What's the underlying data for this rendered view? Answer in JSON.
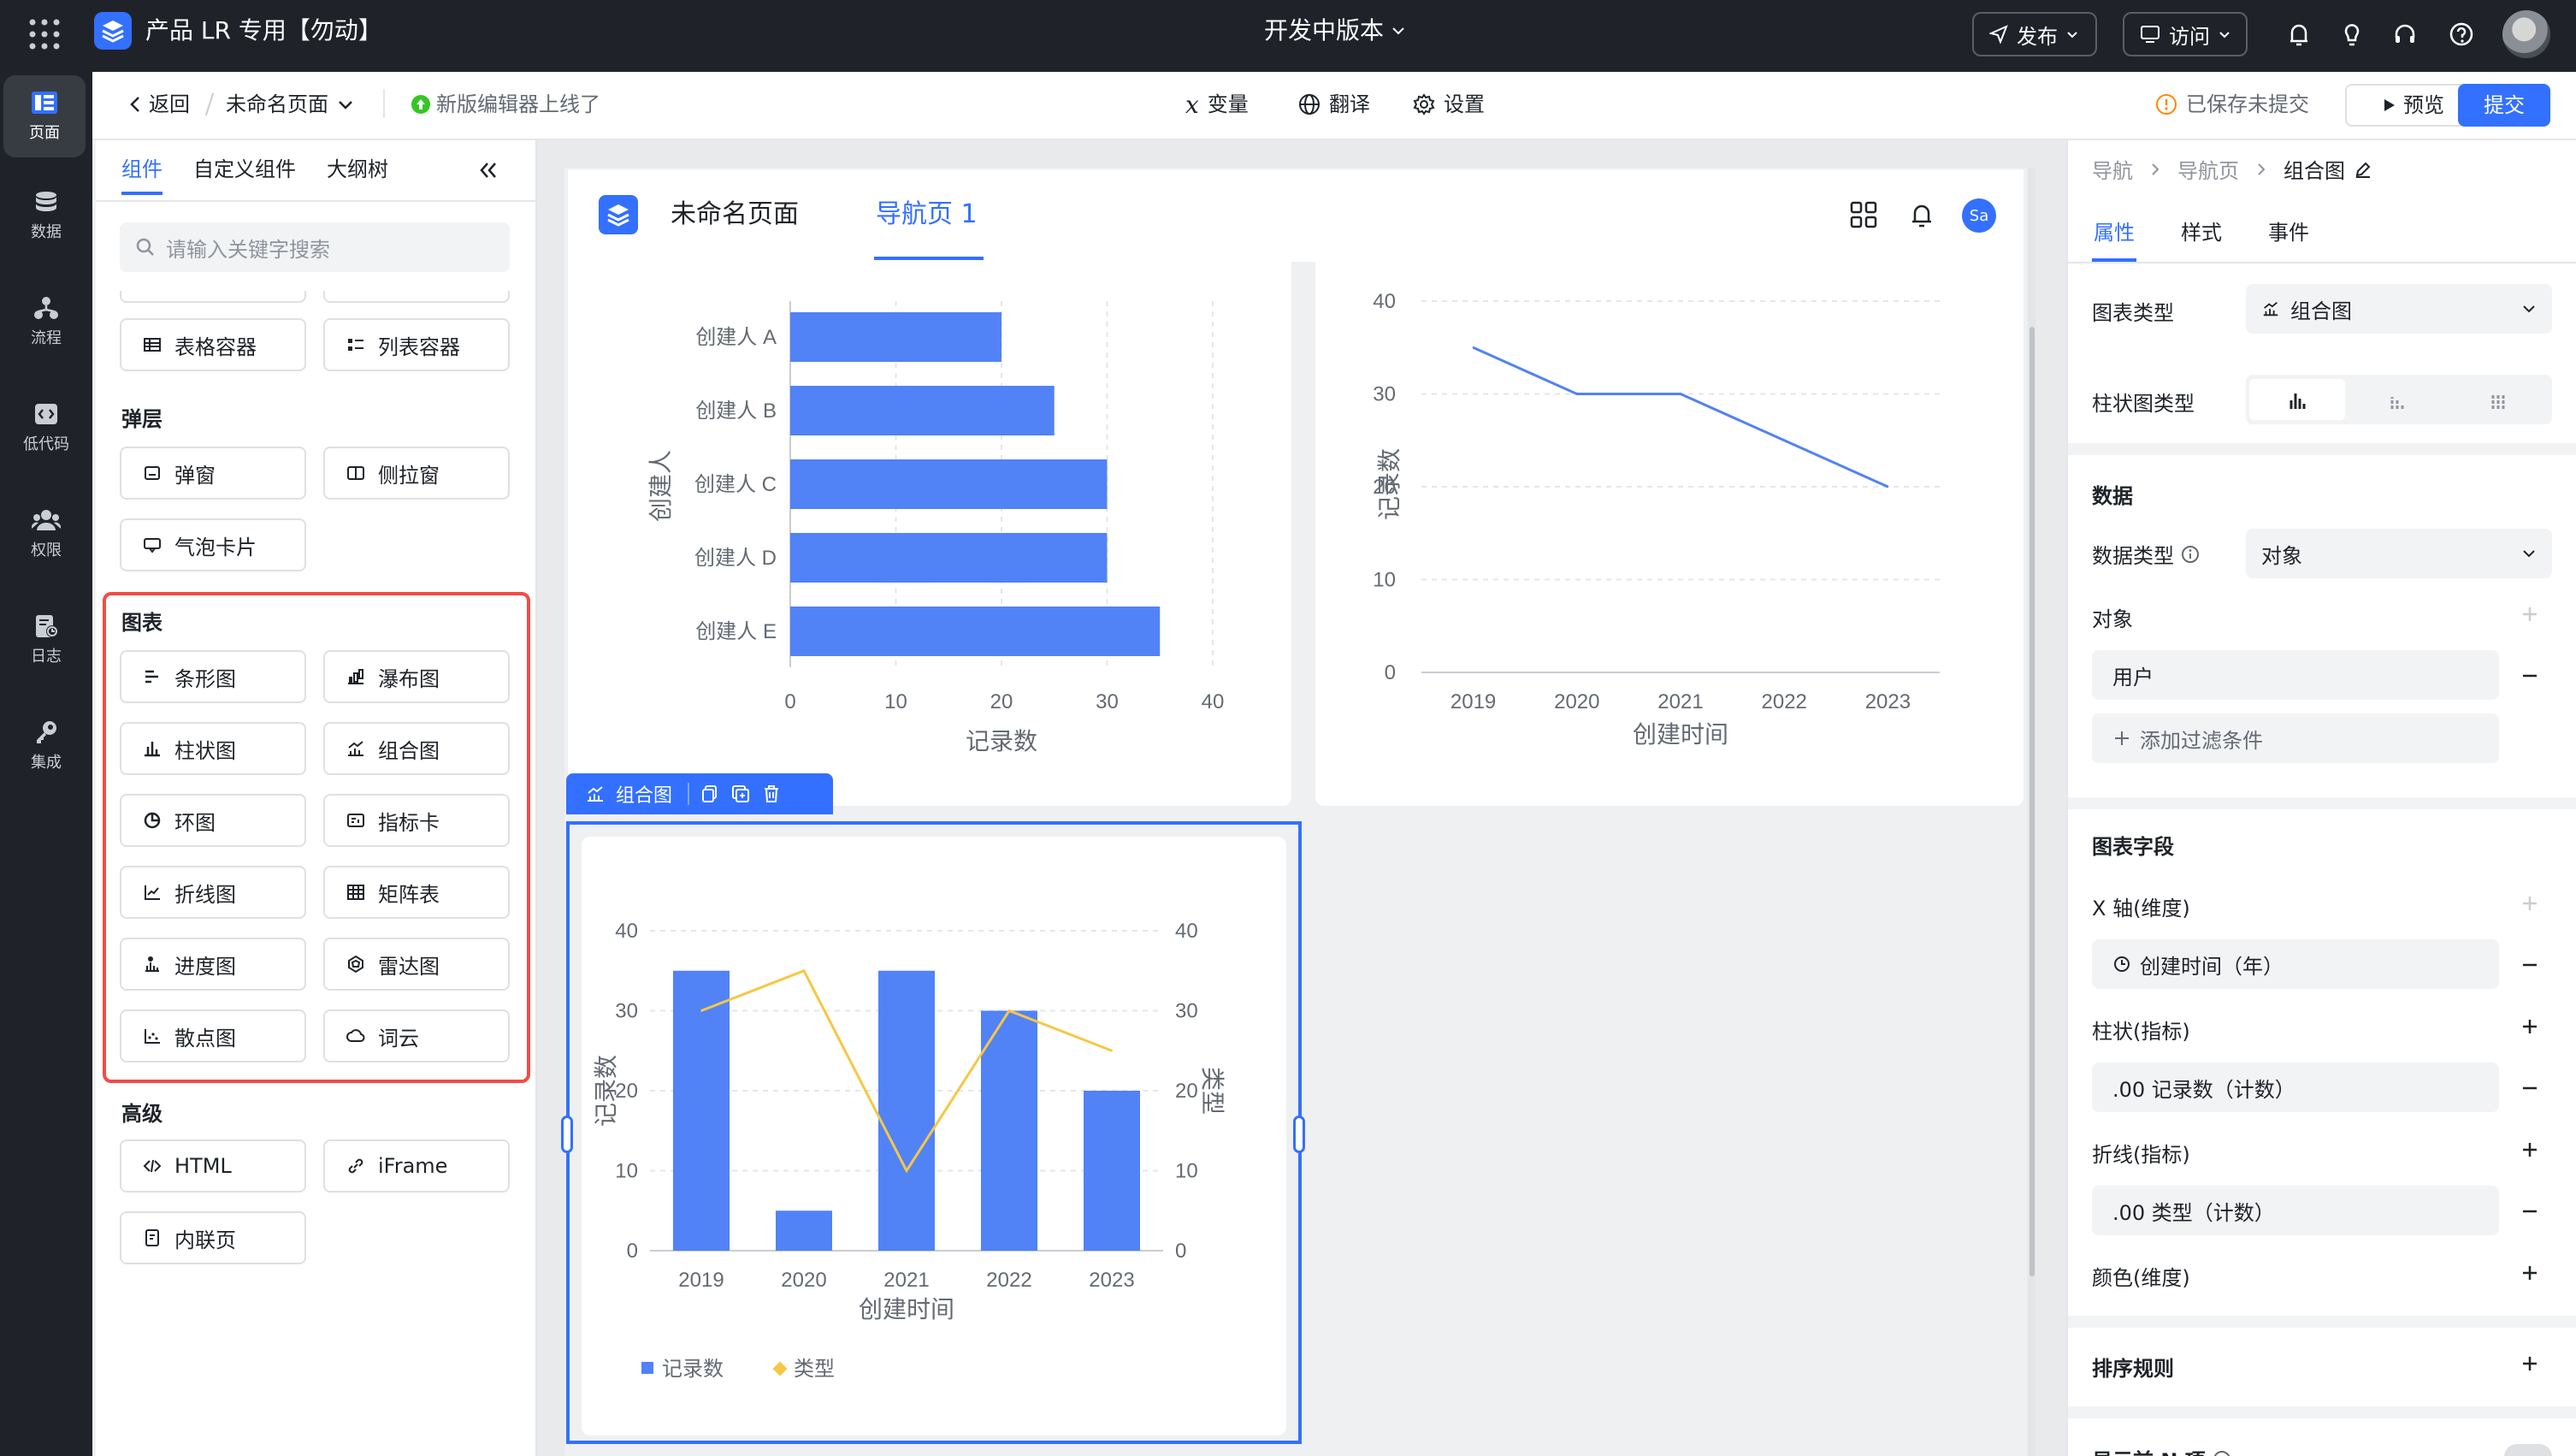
{
  "topbar": {
    "app_title": "产品 LR 专用【勿动】",
    "version": "开发中版本",
    "publish_label": "发布",
    "visit_label": "访问"
  },
  "rail": {
    "items": [
      {
        "label": "页面",
        "icon": "page-icon"
      },
      {
        "label": "数据",
        "icon": "database-icon"
      },
      {
        "label": "流程",
        "icon": "flow-icon"
      },
      {
        "label": "低代码",
        "icon": "code-icon"
      },
      {
        "label": "权限",
        "icon": "users-icon"
      },
      {
        "label": "日志",
        "icon": "log-icon"
      },
      {
        "label": "集成",
        "icon": "key-icon"
      }
    ]
  },
  "subbar": {
    "back_label": "返回",
    "page_name": "未命名页面",
    "notice": "新版编辑器上线了",
    "variables_label": "变量",
    "translate_label": "翻译",
    "settings_label": "设置",
    "saved_status": "已保存未提交",
    "preview_label": "预览",
    "submit_label": "提交"
  },
  "left_panel": {
    "tabs": [
      "组件",
      "自定义组件",
      "大纲树"
    ],
    "search_placeholder": "请输入关键字搜索",
    "containers": [
      "表格容器",
      "列表容器"
    ],
    "popup_title": "弹层",
    "popups": [
      "弹窗",
      "侧拉窗",
      "气泡卡片"
    ],
    "chart_title": "图表",
    "charts": [
      "条形图",
      "瀑布图",
      "柱状图",
      "组合图",
      "环图",
      "指标卡",
      "折线图",
      "矩阵表",
      "进度图",
      "雷达图",
      "散点图",
      "词云"
    ],
    "advanced_title": "高级",
    "advanced": [
      "HTML",
      "iFrame",
      "内联页"
    ]
  },
  "page_header": {
    "title": "未命名页面",
    "nav_tab": "导航页 1",
    "avatar": "Sa"
  },
  "selection_toolbar": {
    "label": "组合图"
  },
  "chart_data": [
    {
      "type": "bar",
      "orientation": "horizontal",
      "categories": [
        "创建人 A",
        "创建人 B",
        "创建人 C",
        "创建人 D",
        "创建人 E"
      ],
      "values": [
        20,
        25,
        30,
        30,
        35
      ],
      "xlabel": "记录数",
      "ylabel": "创建人",
      "xlim": [
        0,
        40
      ],
      "xticks": [
        "0",
        "10",
        "20",
        "30",
        "40"
      ],
      "color": "#5182f6"
    },
    {
      "type": "line",
      "x": [
        "2019",
        "2020",
        "2021",
        "2022",
        "2023"
      ],
      "values": [
        35,
        30,
        30,
        25,
        20
      ],
      "xlabel": "创建时间",
      "ylabel": "记录数",
      "ylim": [
        0,
        40
      ],
      "yticks": [
        "0",
        "10",
        "20",
        "30",
        "40"
      ],
      "color": "#5182f6"
    },
    {
      "type": "bar",
      "combo": true,
      "categories": [
        "2019",
        "2020",
        "2021",
        "2022",
        "2023"
      ],
      "series": [
        {
          "name": "记录数",
          "type": "bar",
          "values": [
            35,
            5,
            35,
            30,
            20
          ],
          "color": "#5182f6"
        },
        {
          "name": "类型",
          "type": "line",
          "values": [
            30,
            35,
            10,
            30,
            25
          ],
          "color": "#f7c744"
        }
      ],
      "xlabel": "创建时间",
      "ylabel": "记录数",
      "y2label": "类型",
      "ylim": [
        0,
        40
      ],
      "yticks": [
        "0",
        "10",
        "20",
        "30",
        "40"
      ],
      "legend": "bottom-left"
    }
  ],
  "right_panel": {
    "breadcrumb": [
      "导航",
      "导航页",
      "组合图"
    ],
    "tabs": [
      "属性",
      "样式",
      "事件"
    ],
    "chart_type_label": "图表类型",
    "chart_type_value": "组合图",
    "bar_type_label": "柱状图类型",
    "data_title": "数据",
    "data_type_label": "数据类型",
    "data_type_value": "对象",
    "object_label": "对象",
    "object_value": "用户",
    "add_filter": "添加过滤条件",
    "fields_title": "图表字段",
    "x_axis_label": "X 轴(维度)",
    "x_axis_value": "创建时间（年）",
    "bar_metric_label": "柱状(指标)",
    "bar_metric_value": ".00 记录数（计数）",
    "line_metric_label": "折线(指标)",
    "line_metric_value": ".00 类型（计数）",
    "color_label": "颜色(维度)",
    "sort_title": "排序规则",
    "top_n_label": "显示前 N 项"
  }
}
